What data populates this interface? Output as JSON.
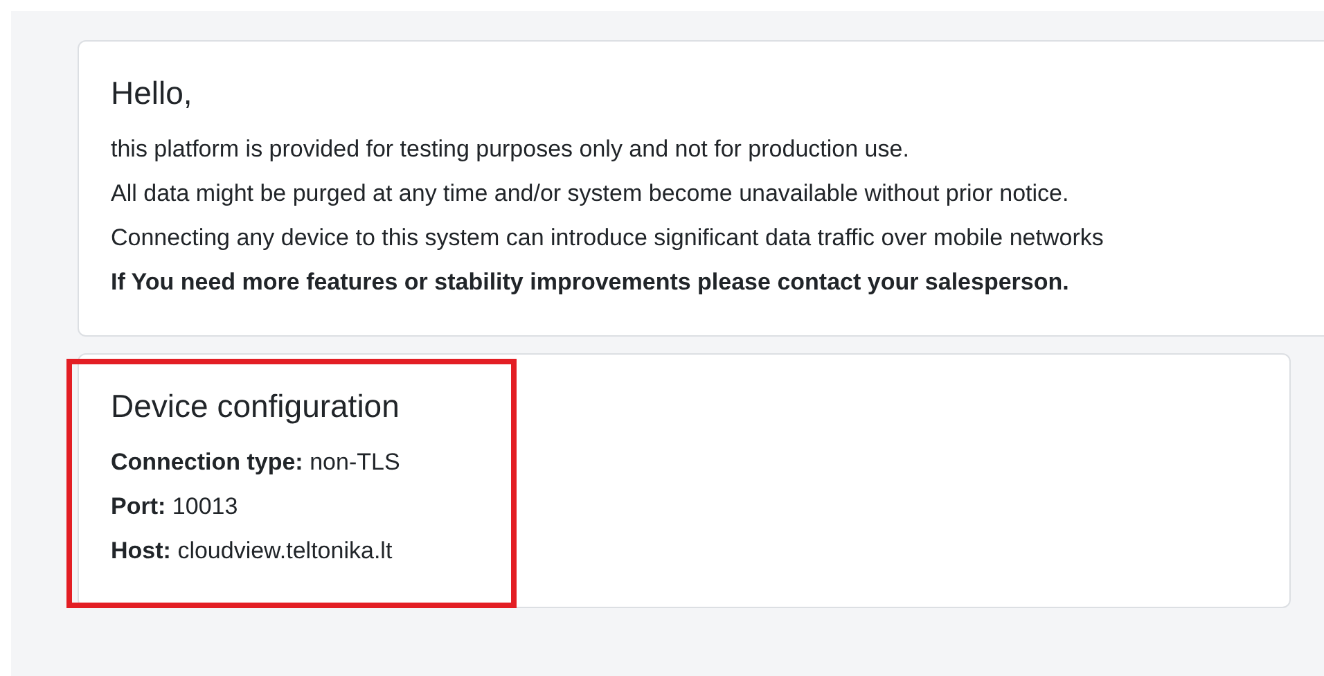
{
  "notice_card": {
    "title": "Hello,",
    "lines": [
      {
        "text": "this platform is provided for testing purposes only and not for production use.",
        "bold": false
      },
      {
        "text": "All data might be purged at any time and/or system become unavailable without prior notice.",
        "bold": false
      },
      {
        "text": "Connecting any device to this system can introduce significant data traffic over mobile networks",
        "bold": false
      },
      {
        "text": "If You need more features or stability improvements please contact your salesperson.",
        "bold": true
      }
    ]
  },
  "config_card": {
    "title": "Device configuration",
    "highlighted": true,
    "fields": [
      {
        "label": "Connection type:",
        "value": "non-TLS"
      },
      {
        "label": "Port:",
        "value": "10013"
      },
      {
        "label": "Host:",
        "value": "cloudview.teltonika.lt"
      }
    ]
  }
}
